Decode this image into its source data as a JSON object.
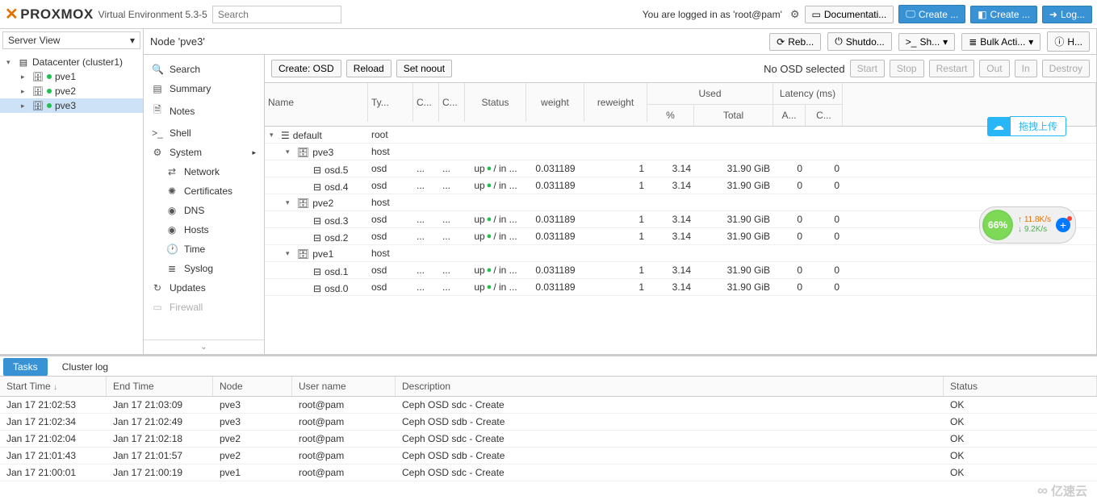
{
  "header": {
    "brand": "PROXMOX",
    "version": "Virtual Environment 5.3-5",
    "search_placeholder": "Search",
    "login_text": "You are logged in as 'root@pam'",
    "docs_btn": "Documentati...",
    "create_vm": "Create ...",
    "create_ct": "Create ...",
    "logout": "Log..."
  },
  "left": {
    "view": "Server View",
    "root": "Datacenter (cluster1)",
    "nodes": [
      "pve1",
      "pve2",
      "pve3"
    ],
    "selected": "pve3"
  },
  "path": {
    "label": "Node 'pve3'",
    "reboot": "Reb...",
    "shutdown": "Shutdo...",
    "shell": "Sh...",
    "bulk": "Bulk Acti...",
    "help": "H..."
  },
  "submenu": {
    "items": [
      {
        "icon": "🔍",
        "label": "Search"
      },
      {
        "icon": "▤",
        "label": "Summary"
      },
      {
        "icon": "🗎",
        "label": "Notes"
      },
      {
        "icon": ">_",
        "label": "Shell"
      },
      {
        "icon": "⚙",
        "label": "System",
        "expandable": true
      },
      {
        "icon": "⇄",
        "label": "Network",
        "sub": true
      },
      {
        "icon": "✺",
        "label": "Certificates",
        "sub": true
      },
      {
        "icon": "◉",
        "label": "DNS",
        "sub": true
      },
      {
        "icon": "◉",
        "label": "Hosts",
        "sub": true
      },
      {
        "icon": "🕐",
        "label": "Time",
        "sub": true
      },
      {
        "icon": "≣",
        "label": "Syslog",
        "sub": true
      },
      {
        "icon": "↻",
        "label": "Updates"
      },
      {
        "icon": "▭",
        "label": "Firewall",
        "faded": true
      }
    ]
  },
  "toolbar": {
    "create_osd": "Create: OSD",
    "reload": "Reload",
    "noout": "Set noout",
    "nosel": "No OSD selected",
    "start": "Start",
    "stop": "Stop",
    "restart": "Restart",
    "out": "Out",
    "in": "In",
    "destroy": "Destroy"
  },
  "osd_cols": {
    "name": "Name",
    "type": "Ty...",
    "c1": "C...",
    "c2": "C...",
    "status": "Status",
    "weight": "weight",
    "reweight": "reweight",
    "used": "Used",
    "pct": "%",
    "total": "Total",
    "latency": "Latency (ms)",
    "a": "A...",
    "cl": "C..."
  },
  "osd_rows": [
    {
      "lvl": 0,
      "name": "default",
      "type": "root",
      "icon": "tri"
    },
    {
      "lvl": 1,
      "name": "pve3",
      "type": "host",
      "icon": "host",
      "exp": true
    },
    {
      "lvl": 2,
      "name": "osd.5",
      "type": "osd",
      "icon": "disk",
      "status": "up ● / in ...",
      "weight": "0.031189",
      "reweight": "1",
      "pct": "3.14",
      "total": "31.90 GiB",
      "a": "0",
      "c": "0"
    },
    {
      "lvl": 2,
      "name": "osd.4",
      "type": "osd",
      "icon": "disk",
      "status": "up ● / in ...",
      "weight": "0.031189",
      "reweight": "1",
      "pct": "3.14",
      "total": "31.90 GiB",
      "a": "0",
      "c": "0"
    },
    {
      "lvl": 1,
      "name": "pve2",
      "type": "host",
      "icon": "host",
      "exp": true
    },
    {
      "lvl": 2,
      "name": "osd.3",
      "type": "osd",
      "icon": "disk",
      "status": "up ● / in ...",
      "weight": "0.031189",
      "reweight": "1",
      "pct": "3.14",
      "total": "31.90 GiB",
      "a": "0",
      "c": "0"
    },
    {
      "lvl": 2,
      "name": "osd.2",
      "type": "osd",
      "icon": "disk",
      "status": "up ● / in ...",
      "weight": "0.031189",
      "reweight": "1",
      "pct": "3.14",
      "total": "31.90 GiB",
      "a": "0",
      "c": "0"
    },
    {
      "lvl": 1,
      "name": "pve1",
      "type": "host",
      "icon": "host",
      "exp": true
    },
    {
      "lvl": 2,
      "name": "osd.1",
      "type": "osd",
      "icon": "disk",
      "status": "up ● / in ...",
      "weight": "0.031189",
      "reweight": "1",
      "pct": "3.14",
      "total": "31.90 GiB",
      "a": "0",
      "c": "0"
    },
    {
      "lvl": 2,
      "name": "osd.0",
      "type": "osd",
      "icon": "disk",
      "status": "up ● / in ...",
      "weight": "0.031189",
      "reweight": "1",
      "pct": "3.14",
      "total": "31.90 GiB",
      "a": "0",
      "c": "0"
    }
  ],
  "tabs": {
    "tasks": "Tasks",
    "cluster": "Cluster log"
  },
  "log_cols": {
    "start": "Start Time",
    "end": "End Time",
    "node": "Node",
    "user": "User name",
    "desc": "Description",
    "status": "Status"
  },
  "log_rows": [
    {
      "st": "Jan 17 21:02:53",
      "et": "Jan 17 21:03:09",
      "nd": "pve3",
      "un": "root@pam",
      "de": "Ceph OSD sdc - Create",
      "ok": "OK"
    },
    {
      "st": "Jan 17 21:02:34",
      "et": "Jan 17 21:02:49",
      "nd": "pve3",
      "un": "root@pam",
      "de": "Ceph OSD sdb - Create",
      "ok": "OK"
    },
    {
      "st": "Jan 17 21:02:04",
      "et": "Jan 17 21:02:18",
      "nd": "pve2",
      "un": "root@pam",
      "de": "Ceph OSD sdc - Create",
      "ok": "OK"
    },
    {
      "st": "Jan 17 21:01:43",
      "et": "Jan 17 21:01:57",
      "nd": "pve2",
      "un": "root@pam",
      "de": "Ceph OSD sdb - Create",
      "ok": "OK"
    },
    {
      "st": "Jan 17 21:00:01",
      "et": "Jan 17 21:00:19",
      "nd": "pve1",
      "un": "root@pam",
      "de": "Ceph OSD sdc - Create",
      "ok": "OK"
    }
  ],
  "widgets": {
    "upload_label": "拖拽上传",
    "speed_pct": "66%",
    "speed_up": "↑ 11.8K/s",
    "speed_dn": "↓ 9.2K/s"
  },
  "watermark": "亿速云"
}
